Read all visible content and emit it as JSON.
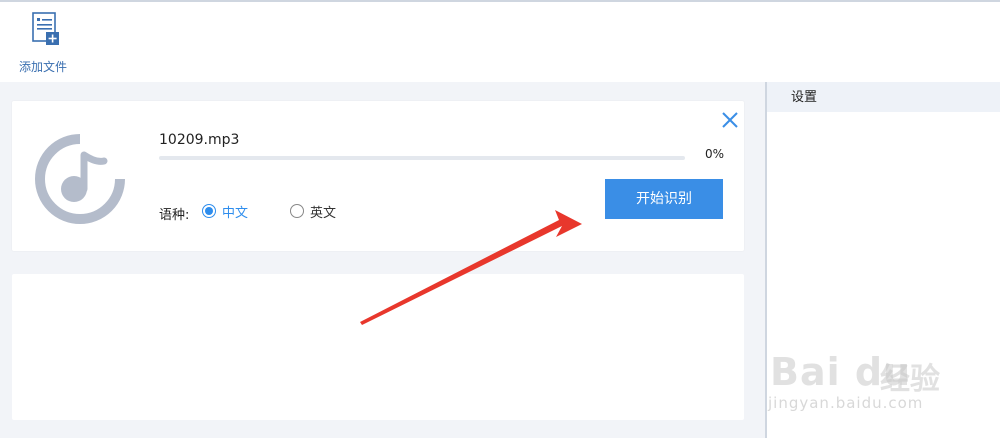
{
  "toolbar": {
    "add_file_label": "添加文件"
  },
  "file_card": {
    "file_name": "10209.mp3",
    "progress_text": "0%",
    "progress_value": 0,
    "language_label": "语种:",
    "language_options": [
      {
        "label": "中文",
        "selected": true
      },
      {
        "label": "英文",
        "selected": false
      }
    ],
    "start_button_label": "开始识别"
  },
  "sidebar": {
    "title": "设置"
  },
  "watermark": {
    "brand": "Bai du",
    "brand_cn": "经验",
    "url": "jingyan.baidu.com"
  },
  "colors": {
    "accent": "#3a8ee6",
    "arrow": "#e8372c",
    "background": "#f2f4f8",
    "icon_gray": "#b4bccb"
  }
}
